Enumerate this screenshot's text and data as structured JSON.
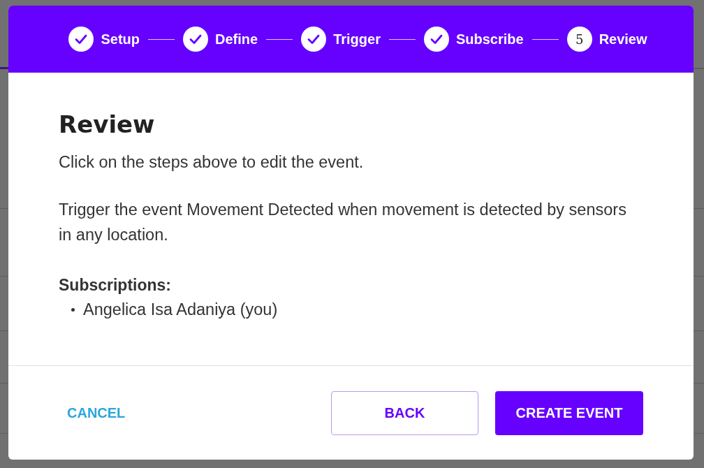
{
  "dialog": {
    "steps": [
      {
        "label": "Setup",
        "completed": true
      },
      {
        "label": "Define",
        "completed": true
      },
      {
        "label": "Trigger",
        "completed": true
      },
      {
        "label": "Subscribe",
        "completed": true
      },
      {
        "label": "Review",
        "completed": false,
        "number": "5"
      }
    ],
    "title": "Review",
    "instruction": "Click on the steps above to edit the event.",
    "summary": "Trigger the event Movement Detected when movement is detected by sensors in any location.",
    "subscriptions_label": "Subscriptions:",
    "subscriptions": [
      "Angelica Isa Adaniya (you)"
    ],
    "buttons": {
      "cancel": "CANCEL",
      "back": "BACK",
      "create": "CREATE EVENT"
    }
  }
}
